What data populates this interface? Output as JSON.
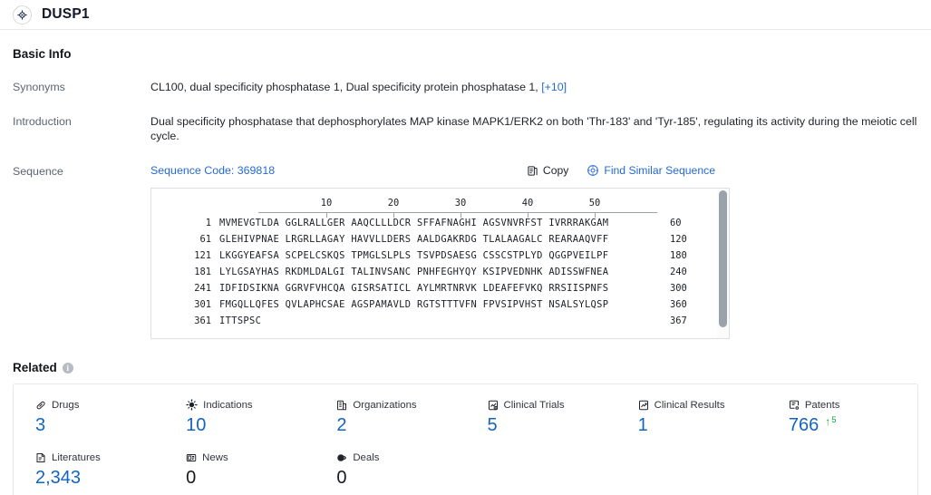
{
  "header": {
    "title": "DUSP1",
    "icon": "target-icon"
  },
  "basic_info": {
    "section_title": "Basic Info",
    "synonyms": {
      "label": "Synonyms",
      "value": "CL100,  dual specificity phosphatase 1,  Dual specificity protein phosphatase 1,",
      "more_link": "[+10]"
    },
    "introduction": {
      "label": "Introduction",
      "value": "Dual specificity phosphatase that dephosphorylates MAP kinase MAPK1/ERK2 on both 'Thr-183' and 'Tyr-185', regulating its activity during the meiotic cell cycle."
    },
    "sequence": {
      "label": "Sequence",
      "code_label": "Sequence Code: 369818",
      "copy_label": "Copy",
      "copy_icon": "copy-icon",
      "find_similar_label": "Find Similar Sequence",
      "find_similar_icon": "target-icon",
      "ruler": [
        10,
        20,
        30,
        40,
        50
      ],
      "rows": [
        {
          "start": "1",
          "chunks": "MVMEVGTLDA GGLRALLGER AAQCLLLDCR SFFAFNAGHI AGSVNVRFST IVRRRAKGAM",
          "end": "60"
        },
        {
          "start": "61",
          "chunks": "GLEHIVPNAE LRGRLLAGAY HAVVLLDERS AALDGAKRDG TLALAAGALC REARAAQVFF",
          "end": "120"
        },
        {
          "start": "121",
          "chunks": "LKGGYEAFSA SCPELCSKQS TPMGLSLPLS TSVPDSAESG CSSCSTPLYD QGGPVEILPF",
          "end": "180"
        },
        {
          "start": "181",
          "chunks": "LYLGSAYHAS RKDMLDALGI TALINVSANC PNHFEGHYQY KSIPVEDNHK ADISSWFNEA",
          "end": "240"
        },
        {
          "start": "241",
          "chunks": "IDFIDSIKNA GGRVFVHCQA GISRSATICL AYLMRTNRVK LDEAFEFVKQ RRSIISPNFS",
          "end": "300"
        },
        {
          "start": "301",
          "chunks": "FMGQLLQFES QVLAPHCSAE AGSPAMAVLD RGTSTTTVFN FPVSIPVHST NSALSYLQSP",
          "end": "360"
        },
        {
          "start": "361",
          "chunks": "ITTSPSC",
          "end": "367"
        }
      ]
    }
  },
  "related": {
    "title": "Related",
    "info_icon": "info-icon",
    "stats": [
      {
        "icon": "pill-icon",
        "label": "Drugs",
        "value": "3",
        "blue": true
      },
      {
        "icon": "virus-icon",
        "label": "Indications",
        "value": "10",
        "blue": true
      },
      {
        "icon": "building-icon",
        "label": "Organizations",
        "value": "2",
        "blue": true
      },
      {
        "icon": "clinical-trial-icon",
        "label": "Clinical Trials",
        "value": "5",
        "blue": true
      },
      {
        "icon": "clinical-result-icon",
        "label": "Clinical Results",
        "value": "1",
        "blue": true
      },
      {
        "icon": "patent-icon",
        "label": "Patents",
        "value": "766",
        "blue": true,
        "delta_arrow": "↑",
        "delta_value": "5"
      },
      {
        "icon": "literature-icon",
        "label": "Literatures",
        "value": "2,343",
        "blue": true
      },
      {
        "icon": "news-icon",
        "label": "News",
        "value": "0",
        "blue": false
      },
      {
        "icon": "deals-icon",
        "label": "Deals",
        "value": "0",
        "blue": false
      }
    ]
  },
  "colors": {
    "link_blue": "#2569d4",
    "stat_blue": "#1264c2",
    "delta_green": "#18a145"
  }
}
